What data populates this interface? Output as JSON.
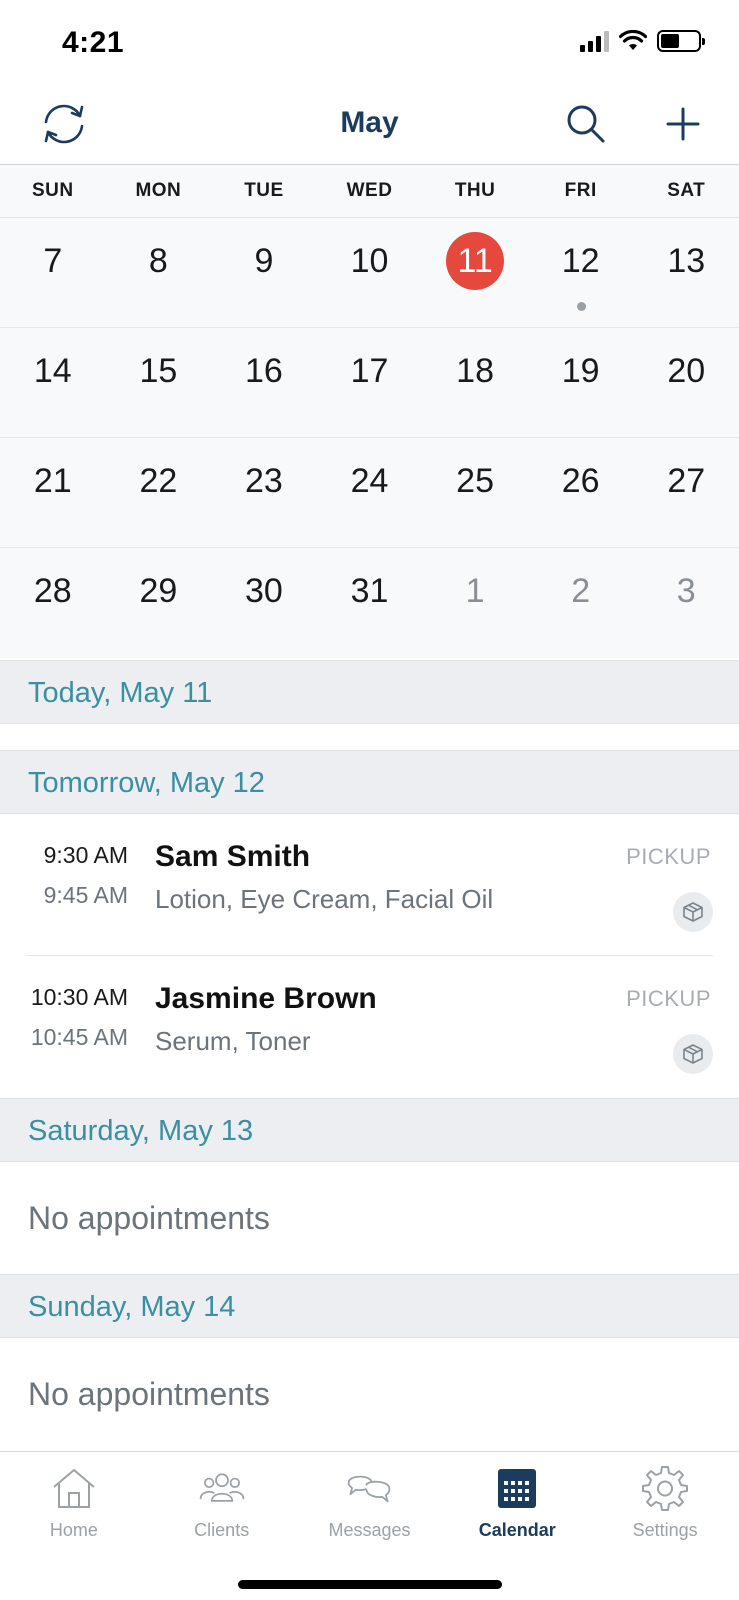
{
  "status_bar": {
    "time": "4:21"
  },
  "header": {
    "title": "May"
  },
  "weekdays": [
    "SUN",
    "MON",
    "TUE",
    "WED",
    "THU",
    "FRI",
    "SAT"
  ],
  "calendar": {
    "rows": [
      [
        {
          "day": "7"
        },
        {
          "day": "8"
        },
        {
          "day": "9"
        },
        {
          "day": "10"
        },
        {
          "day": "11",
          "today": true
        },
        {
          "day": "12",
          "has_events": true
        },
        {
          "day": "13"
        }
      ],
      [
        {
          "day": "14"
        },
        {
          "day": "15"
        },
        {
          "day": "16"
        },
        {
          "day": "17"
        },
        {
          "day": "18"
        },
        {
          "day": "19"
        },
        {
          "day": "20"
        }
      ],
      [
        {
          "day": "21"
        },
        {
          "day": "22"
        },
        {
          "day": "23"
        },
        {
          "day": "24"
        },
        {
          "day": "25"
        },
        {
          "day": "26"
        },
        {
          "day": "27"
        }
      ],
      [
        {
          "day": "28"
        },
        {
          "day": "29"
        },
        {
          "day": "30"
        },
        {
          "day": "31"
        },
        {
          "day": "1",
          "other_month": true
        },
        {
          "day": "2",
          "other_month": true
        },
        {
          "day": "3",
          "other_month": true
        }
      ]
    ],
    "today_color": "#e5483d"
  },
  "agenda": {
    "today_header": "Today, May 11",
    "tomorrow_header": "Tomorrow, May 12",
    "appointments": [
      {
        "start": "9:30 AM",
        "end": "9:45 AM",
        "client": "Sam Smith",
        "items": "Lotion, Eye Cream, Facial Oil",
        "type": "PICKUP",
        "icon": "package-icon"
      },
      {
        "start": "10:30 AM",
        "end": "10:45 AM",
        "client": "Jasmine Brown",
        "items": "Serum, Toner",
        "type": "PICKUP",
        "icon": "package-icon"
      }
    ],
    "saturday_header": "Saturday, May 13",
    "saturday_empty": "No appointments",
    "sunday_header": "Sunday, May 14",
    "sunday_empty": "No appointments"
  },
  "tabbar": {
    "tabs": [
      {
        "label": "Home",
        "icon": "home-icon"
      },
      {
        "label": "Clients",
        "icon": "clients-icon"
      },
      {
        "label": "Messages",
        "icon": "messages-icon"
      },
      {
        "label": "Calendar",
        "icon": "calendar-icon",
        "active": true
      },
      {
        "label": "Settings",
        "icon": "gear-icon"
      }
    ]
  },
  "colors": {
    "brand": "#1b3c5c",
    "accent_teal": "#3a8fa1",
    "today": "#e5483d"
  }
}
